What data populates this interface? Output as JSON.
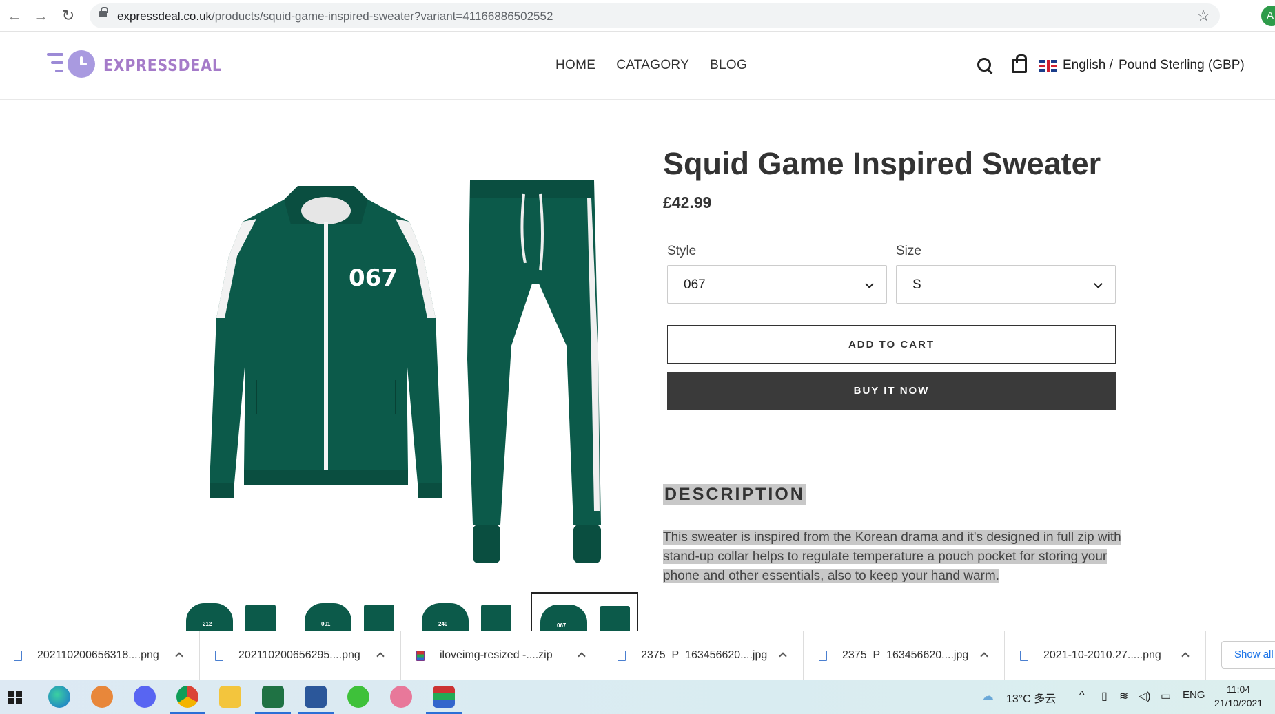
{
  "browser": {
    "url_host": "expressdeal.co.uk",
    "url_path": "/products/squid-game-inspired-sweater?variant=41166886502552",
    "profile_initial": "A"
  },
  "header": {
    "logo_text": "EXPRESSDEAL",
    "nav": [
      "HOME",
      "CATAGORY",
      "BLOG"
    ],
    "language": "English /",
    "currency": "Pound Sterling (GBP)"
  },
  "product": {
    "title": "Squid Game Inspired Sweater",
    "price": "£42.99",
    "jacket_number": "067",
    "thumb_numbers": [
      "212",
      "001",
      "240",
      "067"
    ],
    "style_label": "Style",
    "style_value": "067",
    "size_label": "Size",
    "size_value": "S",
    "add_to_cart": "ADD TO CART",
    "buy_now": "BUY IT NOW",
    "description_heading": "DESCRIPTION",
    "description": "This sweater is inspired from the Korean drama and it's designed in full zip with stand-up collar helps to regulate temperature a pouch pocket for storing your phone and other essentials, also to keep your hand warm."
  },
  "downloads": {
    "items": [
      "202110200656318....png",
      "202110200656295....png",
      "iloveimg-resized -....zip",
      "2375_P_163456620....jpg",
      "2375_P_163456620....jpg",
      "2021-10-2010.27.....png"
    ],
    "show_all": "Show all"
  },
  "taskbar": {
    "weather": "13°C  多云",
    "lang": "ENG",
    "time": "11:04",
    "date": "21/10/2021"
  },
  "colors": {
    "tracksuit_green": "#0c5a4a",
    "logo_purple": "#a57bc9",
    "buy_button": "#3a3a3a",
    "highlight": "#c8c8c8"
  }
}
